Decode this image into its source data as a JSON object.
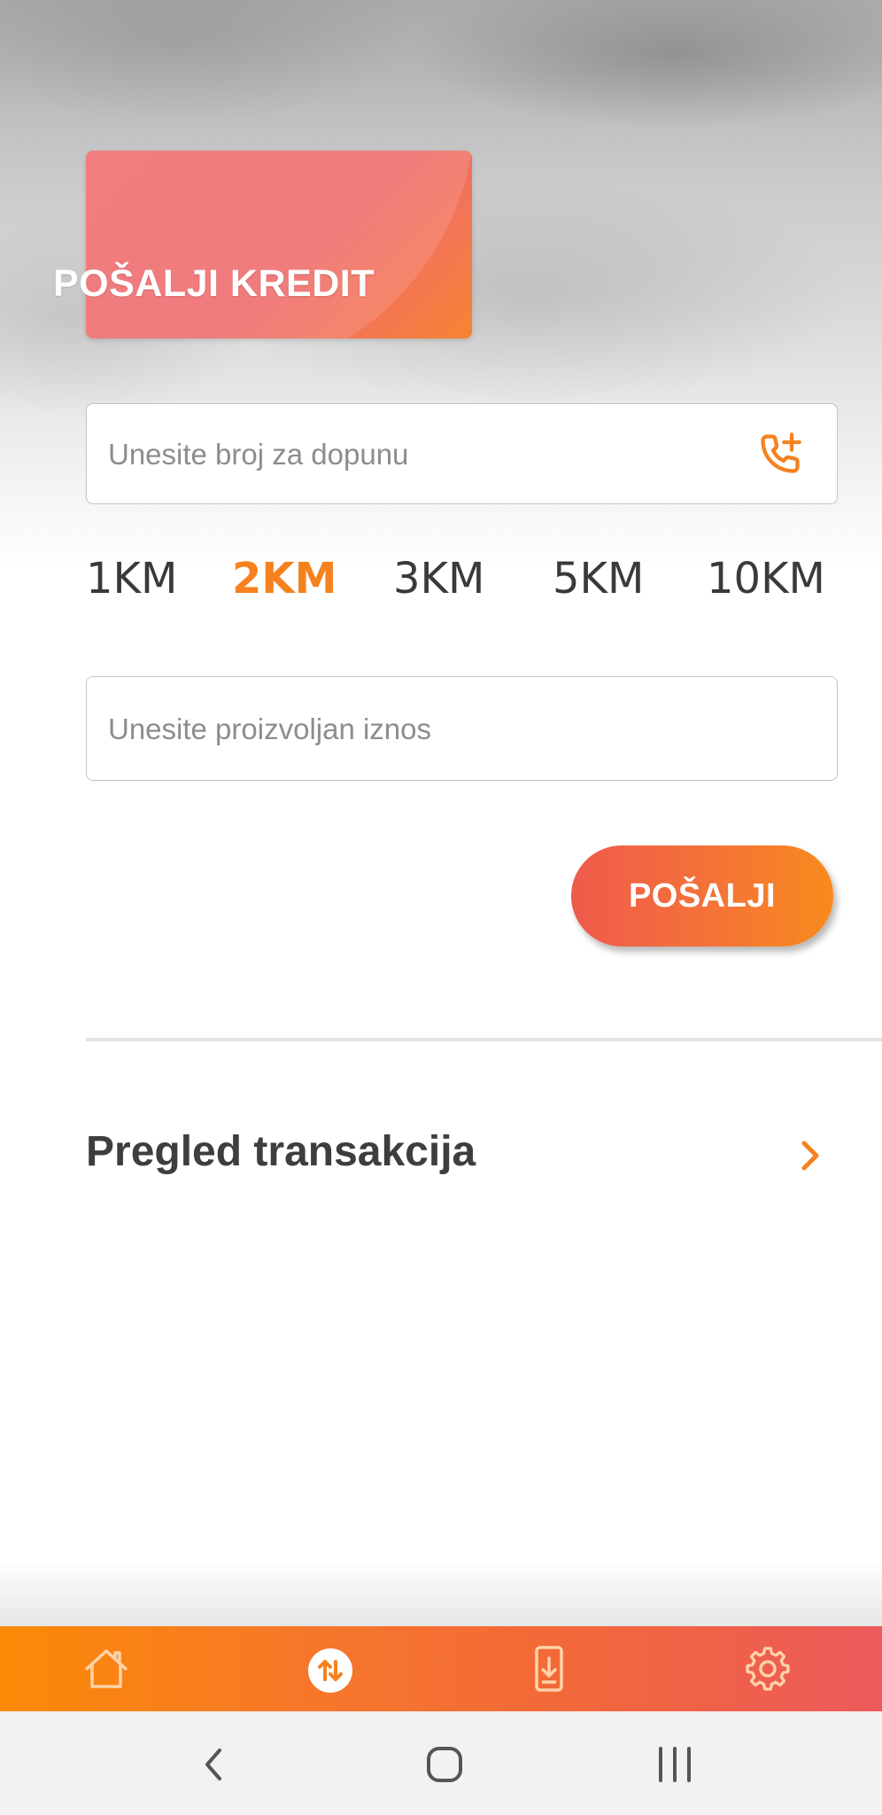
{
  "card": {
    "title": "POŠALJI KREDIT"
  },
  "phone_input": {
    "placeholder": "Unesite broj za dopunu",
    "value": ""
  },
  "amounts": [
    {
      "label": "1KM",
      "selected": false
    },
    {
      "label": "2KM",
      "selected": true
    },
    {
      "label": "3KM",
      "selected": false
    },
    {
      "label": "5KM",
      "selected": false
    },
    {
      "label": "10KM",
      "selected": false
    }
  ],
  "custom_amount_input": {
    "placeholder": "Unesite proizvoljan iznos",
    "value": ""
  },
  "send_button": {
    "label": "POŠALJI"
  },
  "transactions_link": {
    "label": "Pregled transakcija"
  },
  "tabbar": {
    "items": [
      {
        "icon": "home-icon",
        "active": false
      },
      {
        "icon": "transfer-icon",
        "active": true
      },
      {
        "icon": "phone-download-icon",
        "active": false
      },
      {
        "icon": "settings-gear-icon",
        "active": false
      }
    ]
  },
  "system_nav": {
    "buttons": [
      "back-icon",
      "home-circle-icon",
      "recents-icon"
    ]
  },
  "colors": {
    "accent": "#f5821f",
    "card": "#ee6a6c",
    "tabbar_start": "#fb8a06",
    "tabbar_end": "#ec5a5b",
    "text_dark": "#3e3e3e"
  }
}
